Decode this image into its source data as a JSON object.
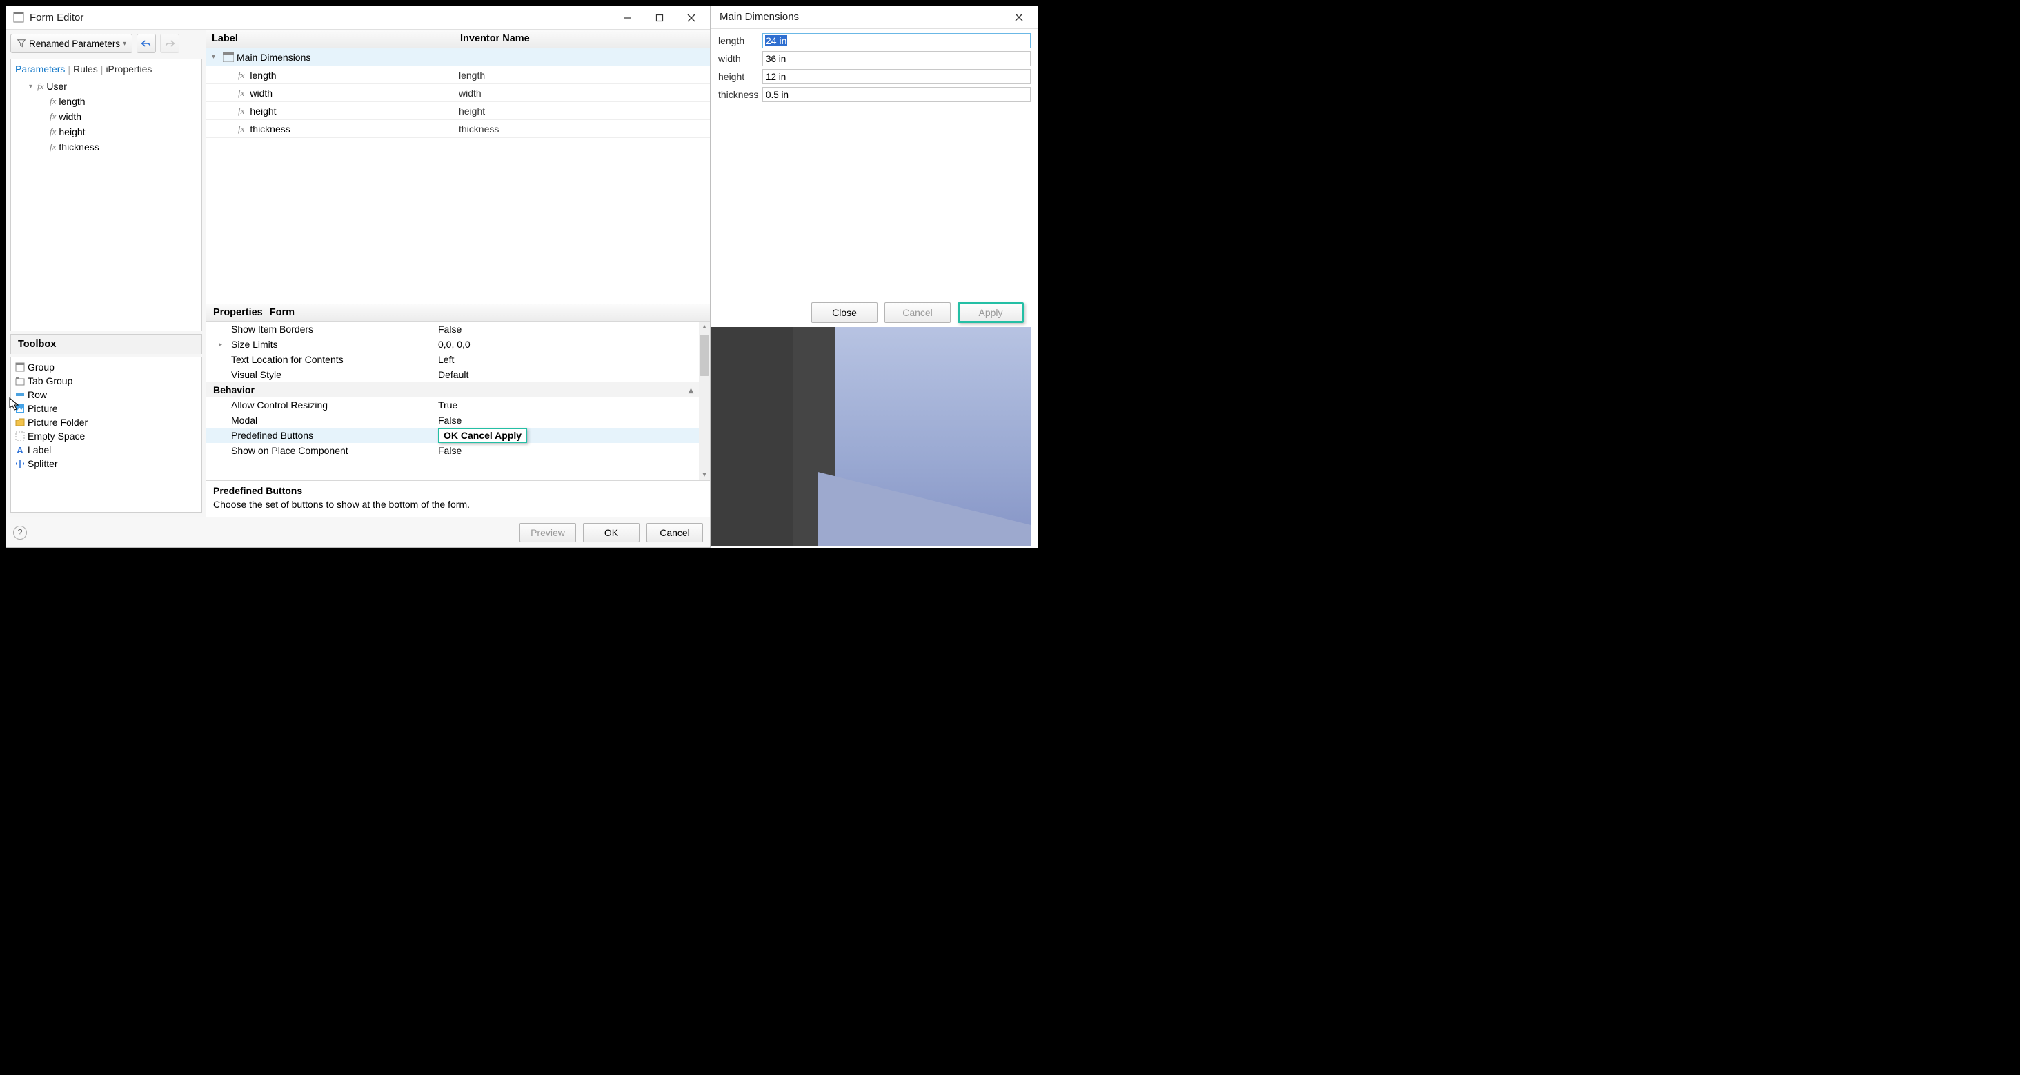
{
  "editor": {
    "title": "Form Editor",
    "renamed_btn": "Renamed Parameters",
    "tabs": {
      "parameters": "Parameters",
      "rules": "Rules",
      "iproperties": "iProperties"
    },
    "tree": {
      "root": "User",
      "items": [
        "length",
        "width",
        "height",
        "thickness"
      ]
    },
    "toolbox": {
      "title": "Toolbox",
      "items": [
        "Group",
        "Tab Group",
        "Row",
        "Picture",
        "Picture Folder",
        "Empty Space",
        "Label",
        "Splitter"
      ]
    },
    "grid": {
      "col_label": "Label",
      "col_inventor": "Inventor Name",
      "group_row": "Main Dimensions",
      "rows": [
        {
          "label": "length",
          "name": "length"
        },
        {
          "label": "width",
          "name": "width"
        },
        {
          "label": "height",
          "name": "height"
        },
        {
          "label": "thickness",
          "name": "thickness"
        }
      ]
    },
    "props": {
      "title1": "Properties",
      "title2": "Form",
      "rows": [
        {
          "name": "Show Item Borders",
          "val": "False"
        },
        {
          "name": "Size Limits",
          "val": "0,0, 0,0",
          "exp": true
        },
        {
          "name": "Text Location for Contents",
          "val": "Left"
        },
        {
          "name": "Visual Style",
          "val": "Default"
        }
      ],
      "cat": "Behavior",
      "rows2": [
        {
          "name": "Allow Control Resizing",
          "val": "True"
        },
        {
          "name": "Modal",
          "val": "False"
        },
        {
          "name": "Predefined Buttons",
          "val": "OK Cancel Apply",
          "sel": true
        },
        {
          "name": "Show on Place Component",
          "val": "False"
        }
      ],
      "help_title": "Predefined Buttons",
      "help_text": "Choose the set of buttons to show at the bottom of the form."
    },
    "footer": {
      "preview": "Preview",
      "ok": "OK",
      "cancel": "Cancel"
    }
  },
  "rightw": {
    "title": "Main Dimensions",
    "fields": [
      {
        "label": "length",
        "value": "24 in",
        "selected": true
      },
      {
        "label": "width",
        "value": "36 in"
      },
      {
        "label": "height",
        "value": "12 in"
      },
      {
        "label": "thickness",
        "value": "0.5 in"
      }
    ],
    "buttons": {
      "close": "Close",
      "cancel": "Cancel",
      "apply": "Apply"
    }
  }
}
